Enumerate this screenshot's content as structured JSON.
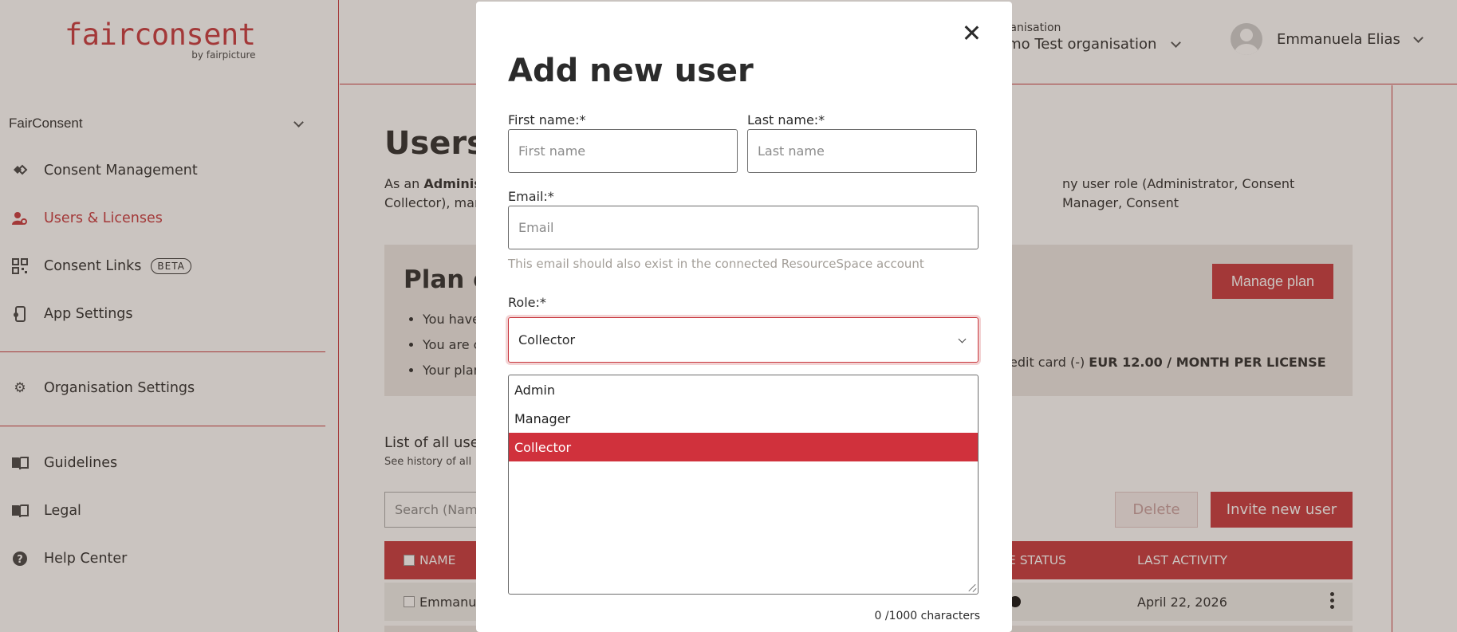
{
  "brand": {
    "logo": "fairconsent",
    "logo_sub": "by fairpicture"
  },
  "sidebar": {
    "group": "FairConsent",
    "items": [
      {
        "label": "Consent Management",
        "icon": "handshake-icon"
      },
      {
        "label": "Users & Licenses",
        "icon": "users-gear-icon",
        "active": true
      },
      {
        "label": "Consent Links",
        "icon": "qr-code-icon",
        "badge": "BETA"
      },
      {
        "label": "App Settings",
        "icon": "mobile-settings-icon"
      },
      {
        "label": "Organisation Settings",
        "icon": "gear-icon"
      },
      {
        "label": "Guidelines",
        "icon": "book-icon"
      },
      {
        "label": "Legal",
        "icon": "book-open-icon"
      },
      {
        "label": "Help Center",
        "icon": "question-circle-icon"
      }
    ]
  },
  "header": {
    "org_caption": "rganisation",
    "org_name": "emo Test organisation",
    "user_name": "Emmanuela Elias"
  },
  "main": {
    "title": "Users",
    "intro_prefix": "As an ",
    "intro_bold": "Administ",
    "intro_right": "ny user role (Administrator, Consent Manager, Consent",
    "intro_line2": "Collector), man",
    "plan": {
      "title": "Plan o",
      "bullets": [
        "You have",
        "You are c",
        "Your plan"
      ],
      "price_prefix": "edit card (-) ",
      "price_bold": "EUR 12.00 / MONTH PER LICENSE",
      "manage_label": "Manage plan"
    },
    "list_title": "List of all user",
    "list_sub": "See history of all",
    "search_placeholder": "Search (Name",
    "delete_label": "Delete",
    "invite_label": "Invite new user",
    "columns": {
      "name": "NAME",
      "status": "E STATUS",
      "last_activity": "LAST ACTIVITY"
    },
    "rows": [
      {
        "name": "Emmanue",
        "last_activity": "April 22, 2026"
      }
    ]
  },
  "modal": {
    "title": "Add new user",
    "first_name_label": "First name:*",
    "first_name_placeholder": "First name",
    "last_name_label": "Last name:*",
    "last_name_placeholder": "Last name",
    "email_label": "Email:*",
    "email_placeholder": "Email",
    "email_hint": "This email should also exist in the connected ResourceSpace account",
    "role_label": "Role:*",
    "role_value": "Collector",
    "role_options": [
      "Admin",
      "Manager",
      "Collector"
    ],
    "char_count": "0 /1000 characters"
  },
  "colors": {
    "accent": "#c8373d",
    "selected_option": "#d0313c",
    "panel": "#ece9e6"
  }
}
